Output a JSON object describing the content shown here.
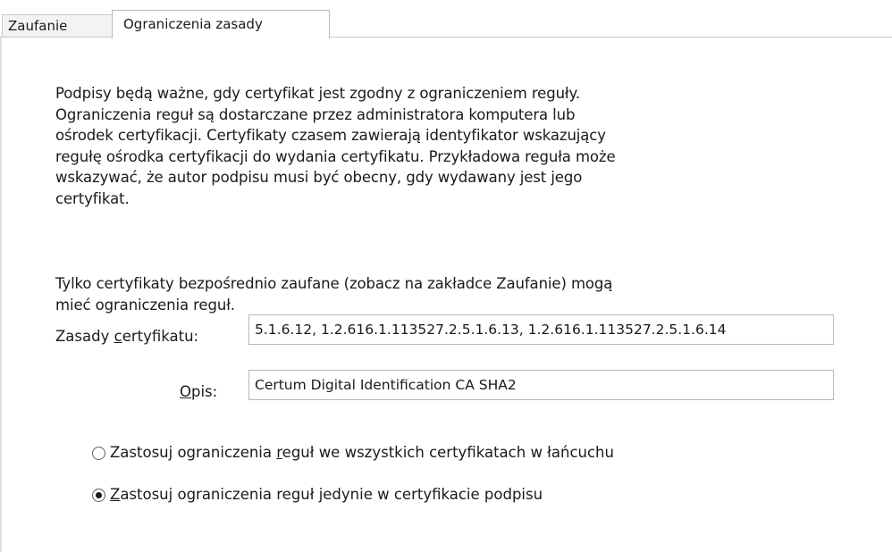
{
  "tabs": {
    "trust": "Zaufanie",
    "policy_restrictions": "Ograniczenia zasady"
  },
  "panel": {
    "description_lines": [
      "Podpisy będą ważne, gdy certyfikat jest zgodny z ograniczeniem reguły.",
      "Ograniczenia reguł są dostarczane przez administratora komputera lub",
      "ośrodek certyfikacji. Certyfikaty czasem zawierają identyfikator wskazujący",
      "regułę ośrodka certyfikacji do wydania certyfikatu. Przykładowa reguła może",
      "wskazywać, że autor podpisu musi być obecny, gdy wydawany jest jego",
      "certyfikat."
    ],
    "note_lines": [
      "Tylko certyfikaty bezpośrednio zaufane (zobacz na zakładce Zaufanie) mogą",
      "mieć ograniczenia reguł."
    ],
    "policy_label_pre": "Zasady ",
    "policy_label_accel": "c",
    "policy_label_post": "ertyfikatu:",
    "policy_value": "5.1.6.12, 1.2.616.1.113527.2.5.1.6.13, 1.2.616.1.113527.2.5.1.6.14",
    "desc_label_accel": "O",
    "desc_label_post": "pis:",
    "desc_value": "Certum Digital Identification CA SHA2",
    "radio_all_pre": "Zastosuj ograniczenia ",
    "radio_all_accel": "r",
    "radio_all_post": "eguł we wszystkich certyfikatach w łańcuchu",
    "radio_all_selected": false,
    "radio_sign_accel": "Z",
    "radio_sign_post": "astosuj ograniczenia reguł jedynie w certyfikacie podpisu",
    "radio_sign_selected": true
  }
}
